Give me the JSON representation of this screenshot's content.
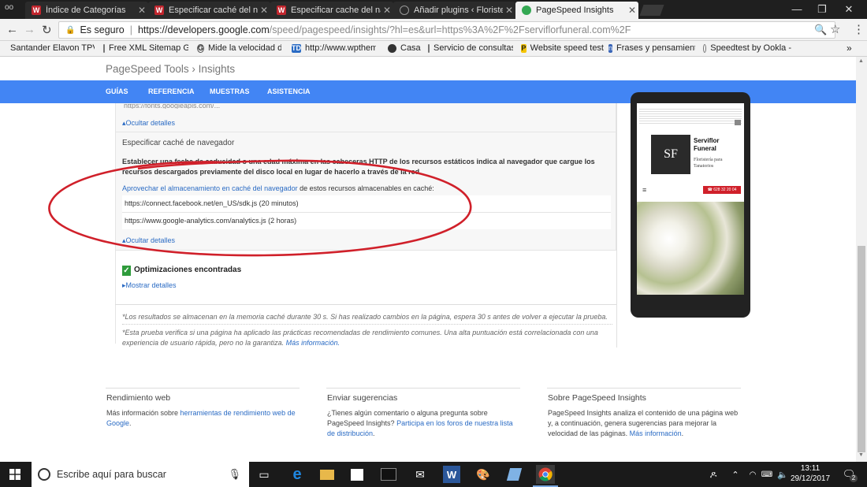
{
  "browser": {
    "tabs": [
      {
        "title": "Índice de Categorías",
        "fav": "W"
      },
      {
        "title": "Especificar caché del nav",
        "fav": "W"
      },
      {
        "title": "Especificar cache del nav",
        "fav": "W"
      },
      {
        "title": "Añadir plugins ‹ Floristeri",
        "fav": "wp"
      },
      {
        "title": "PageSpeed Insights",
        "fav": "g"
      }
    ],
    "close_glyph": "✕",
    "address": {
      "secure_label": "Es seguro",
      "host": "https://developers.google.com",
      "path": "/speed/pagespeed/insights/?hl=es&url=https%3A%2F%2Fserviflorfuneral.com%2F"
    },
    "bookmarks": [
      "Santander Elavon TPV",
      "Free XML Sitemap Ge",
      "Mide la velocidad de",
      "http://www.wptheme",
      "Casa",
      "Servicio de consultas",
      "Website speed test",
      "Frases y pensamiento",
      "Speedtest by Ookla -"
    ],
    "bookmark_icons": [
      "",
      "",
      "G",
      "TD",
      "",
      "",
      "P",
      "n",
      ""
    ],
    "more_glyph": "»"
  },
  "site": {
    "brand": "PageSpeed Tools",
    "separator": "›",
    "section": "Insights",
    "nav": [
      "GUÍAS",
      "REFERENCIA",
      "MUESTRAS",
      "ASISTENCIA"
    ]
  },
  "results": {
    "cut_url": "https://fonts.googleapis.com/...",
    "hide_details_1": "▴Ocultar detalles",
    "rule_title": "Especificar caché de navegador",
    "rule_desc": "Establecer una fecha de caducidad o una edad máxima en las cabeceras HTTP de los recursos estáticos indica al navegador que cargue los recursos descargados previamente del disco local en lugar de hacerlo a través de la red.",
    "leverage_link": "Aprovechar el almacenamiento en caché del navegador",
    "leverage_rest": " de estos recursos almacenables en caché:",
    "resources": [
      "https://connect.facebook.net/en_US/sdk.js (20 minutos)",
      "https://www.google-analytics.com/analytics.js (2 horas)"
    ],
    "hide_details_2": "▴Ocultar detalles",
    "found_title": "Optimizaciones encontradas",
    "show_details": "▸Mostrar detalles",
    "note1": "*Los resultados se almacenan en la memoria caché durante 30 s. Si has realizado cambios en la página, espera 30 s antes de volver a ejecutar la prueba.",
    "note2_text": "*Esta prueba verifica si una página ha aplicado las prácticas recomendadas de rendimiento comunes. Una alta puntuación está correlacionada con una experiencia de usuario rápida, pero no la garantiza. ",
    "note2_link": "Más información."
  },
  "phone": {
    "site_name": "Serviflor Funeral",
    "tagline": "Floristería para Tanatorios",
    "logo": "SF",
    "menu_glyph": "≡",
    "call_button": "☎ 628 32 20 04"
  },
  "footer": [
    {
      "title": "Rendimiento web",
      "pre": "Más información sobre ",
      "link": "herramientas de rendimiento web de Google",
      "post": "."
    },
    {
      "title": "Enviar sugerencias",
      "pre": "¿Tienes algún comentario o alguna pregunta sobre PageSpeed Insights? ",
      "link": "Participa en los foros de nuestra lista de distribución",
      "post": "."
    },
    {
      "title": "Sobre PageSpeed Insights",
      "pre": "PageSpeed Insights analiza el contenido de una página web y, a continuación, genera sugerencias para mejorar la velocidad de las páginas. ",
      "link": "Más información",
      "post": "."
    }
  ],
  "taskbar": {
    "search_placeholder": "Escribe aquí para buscar",
    "time": "13:11",
    "date": "29/12/2017",
    "notification_count": "2"
  },
  "colors": {
    "nav_blue": "#4285f4",
    "link_blue": "#2a6bc4",
    "highlight_red": "#d0202a",
    "check_green": "#2e9b3b"
  }
}
